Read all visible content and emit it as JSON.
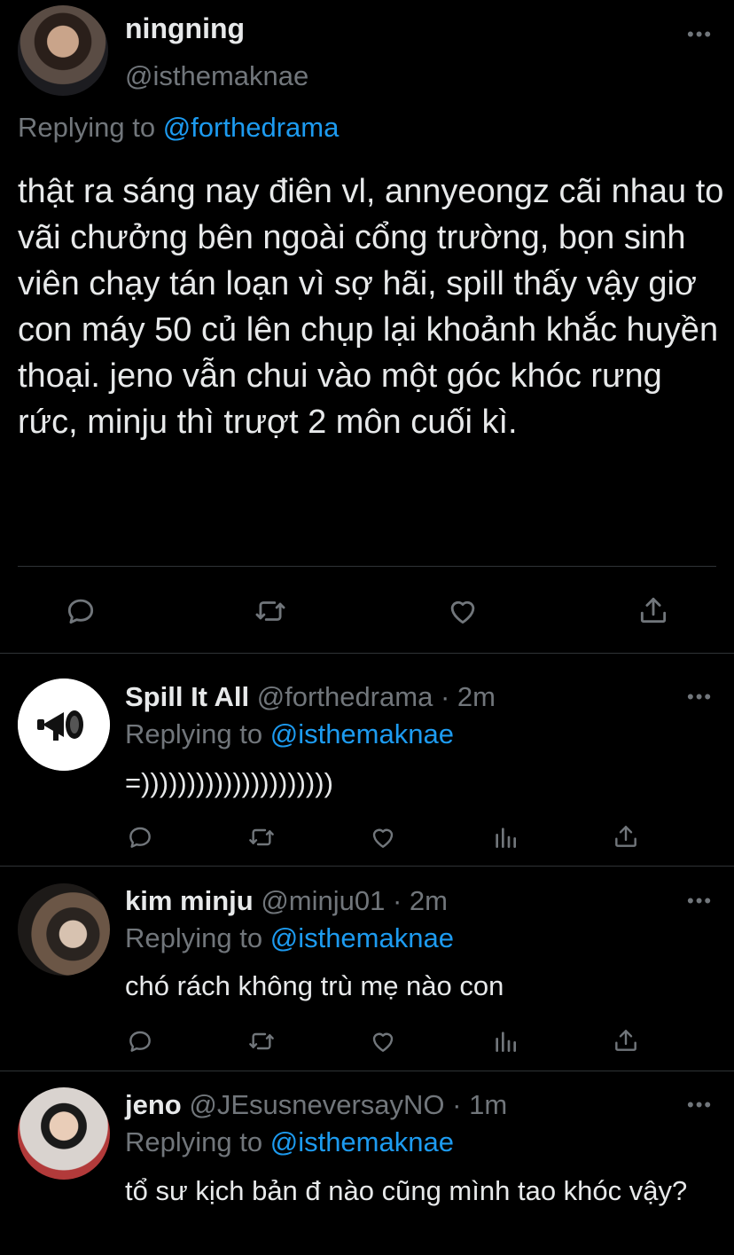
{
  "main_tweet": {
    "display_name": "ningning",
    "handle": "@isthemaknae",
    "replying_prefix": "Replying to ",
    "replying_handle": "@forthedrama",
    "text": "thật ra sáng nay điên vl, annyeongz cãi nhau to vãi chưởng bên ngoài cổng trường, bọn sinh viên chạy tán loạn vì sợ hãi, spill thấy vậy giơ con máy 50 củ lên chụp lại khoảnh khắc huyền thoại. jeno vẫn chui vào một góc khóc rưng rức, minju thì trượt 2 môn cuối kì."
  },
  "replies": [
    {
      "display_name": "Spill It All",
      "handle": "@forthedrama",
      "time": "· 2m",
      "replying_prefix": "Replying to ",
      "replying_handle": "@isthemaknae",
      "text": "=)))))))))))))))))))))"
    },
    {
      "display_name": "kim minju",
      "handle": "@minju01",
      "time": "· 2m",
      "replying_prefix": "Replying to ",
      "replying_handle": "@isthemaknae",
      "text": "chó rách không trù mẹ nào con"
    },
    {
      "display_name": "jeno",
      "handle": "@JEsusneversayNO",
      "time": "· 1m",
      "replying_prefix": "Replying to ",
      "replying_handle": "@isthemaknae",
      "text": "tổ sư kịch bản đ nào cũng mình tao khóc vậy?"
    }
  ],
  "icons": {
    "more": "•••",
    "reply": "reply-icon",
    "retweet": "retweet-icon",
    "like": "heart-icon",
    "analytics": "analytics-icon",
    "share": "share-icon"
  },
  "colors": {
    "background": "#000000",
    "text": "#e7e9ea",
    "muted": "#71767b",
    "link": "#1d9bf0",
    "divider": "#2f3336"
  }
}
